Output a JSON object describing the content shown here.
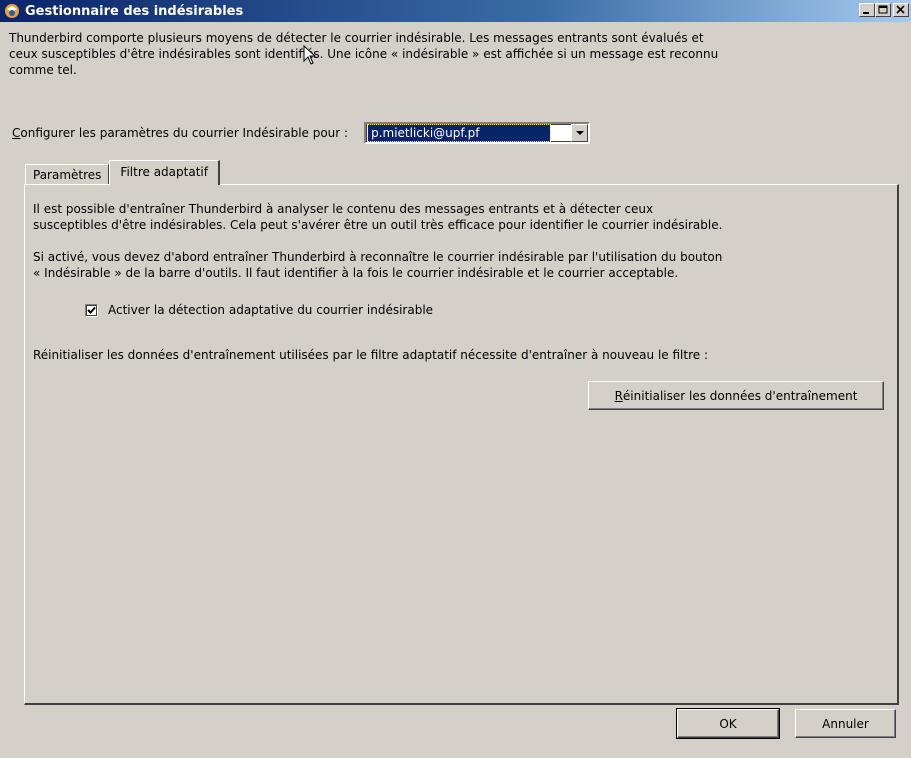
{
  "window": {
    "title": "Gestionnaire des indésirables"
  },
  "intro": {
    "line1": "Thunderbird comporte plusieurs moyens de détecter le courrier indésirable. Les messages entrants sont évalués et",
    "line2": "ceux susceptibles d'être indésirables sont identifiés. Une icône « indésirable » est affichée si un message est reconnu",
    "line3": "comme tel."
  },
  "config": {
    "label_accesskey": "C",
    "label_rest": "onfigurer les paramètres du courrier Indésirable pour :",
    "account": "p.mietlicki@upf.pf"
  },
  "tabs": [
    {
      "label": "Paramètres"
    },
    {
      "label": "Filtre adaptatif"
    }
  ],
  "panel": {
    "para1_line1": "Il est possible d'entraîner Thunderbird à analyser le contenu des messages entrants et à détecter ceux",
    "para1_line2": "susceptibles d'être indésirables. Cela peut s'avérer être un outil très efficace pour identifier le courrier indésirable.",
    "para2_line1": "Si activé, vous devez d'abord entraîner Thunderbird à reconnaître le courrier indésirable par l'utilisation du bouton",
    "para2_line2": "« Indésirable » de la barre d'outils. Il faut identifier à la fois le courrier indésirable et le courrier acceptable.",
    "checkbox_label": "Activer la détection adaptative du courrier indésirable",
    "checkbox_checked": true,
    "reset_text": "Réinitialiser les données d'entraînement utilisées par le filtre adaptatif nécessite d'entraîner à nouveau le filtre :",
    "reset_button_accesskey": "R",
    "reset_button_rest": "éinitialiser les données d'entraînement"
  },
  "footer": {
    "ok_label": "OK",
    "cancel_label": "Annuler"
  }
}
